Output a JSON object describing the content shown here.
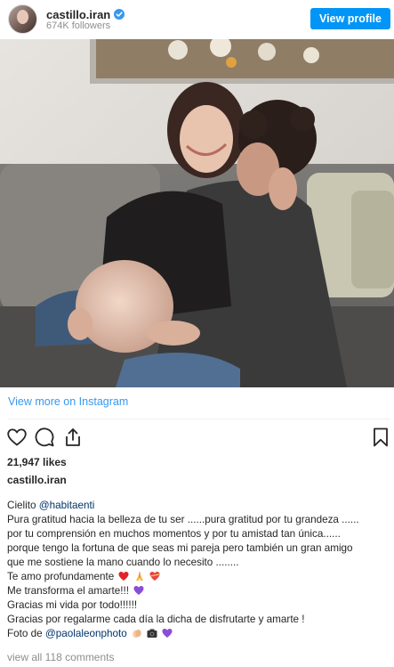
{
  "header": {
    "username": "castillo.iran",
    "followers": "674K followers",
    "view_profile": "View profile"
  },
  "post": {
    "view_more": "View more on Instagram",
    "likes": "21,947 likes",
    "caption_user": "castillo.iran",
    "caption_lines": {
      "l1": "Cielito ",
      "l1_mention": "@habitaenti",
      "l2": "Pura gratitud hacia la belleza de tu ser ......pura gratitud por tu grandeza ......",
      "l3": "por tu comprensión en muchos momentos y por tu amistad tan única......",
      "l4": "porque tengo la fortuna de que seas mi pareja pero también un gran amigo",
      "l5": "que me sostiene la mano cuando lo necesito ........",
      "l6": "Te amo profundamente",
      "l7": "Me transforma el amarte!!!",
      "l8": "Gracias mi vida por todo!!!!!!",
      "l9": "Gracias por regalarme cada día la dicha de disfrutarte y amarte !",
      "l10": "Foto de ",
      "l10_mention": "@paolaleonphoto"
    },
    "comments": "view all 118 comments"
  },
  "icons": {
    "verified": "verified-badge-icon",
    "like": "heart-icon",
    "comment": "comment-icon",
    "share": "share-icon",
    "save": "bookmark-icon"
  },
  "colors": {
    "accent": "#0095f6",
    "link": "#3897f0",
    "mention": "#003569",
    "muted": "#8e8e8e"
  }
}
